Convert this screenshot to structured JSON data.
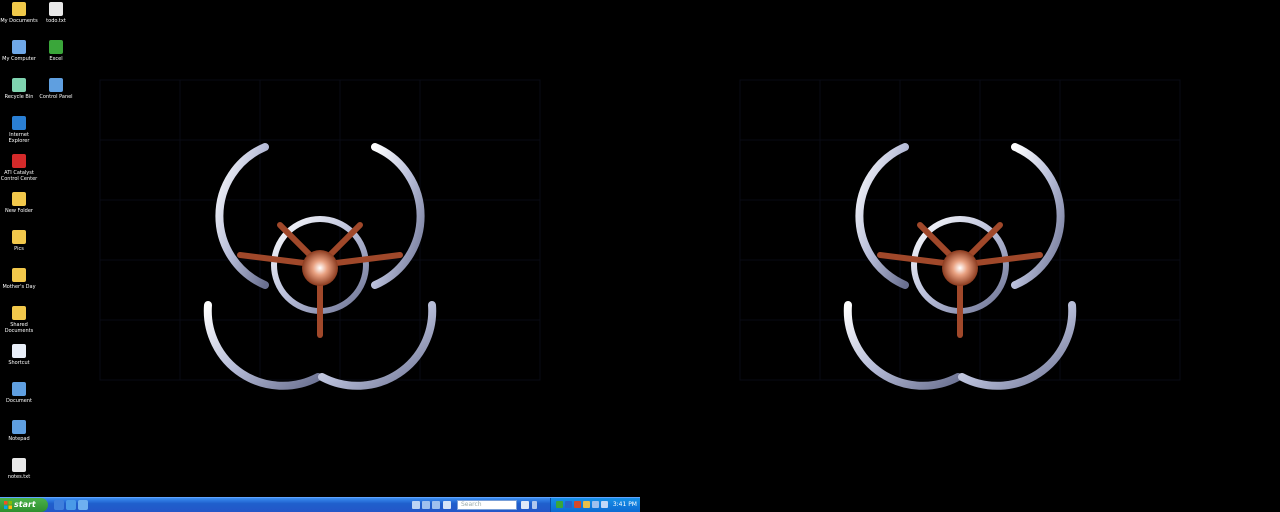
{
  "desktop_icons": [
    {
      "id": "my-documents",
      "label": "My Documents",
      "icon": "folder-documents-icon",
      "color": "#f0c94a",
      "col": 0,
      "row": 0
    },
    {
      "id": "todo",
      "label": "todo.txt",
      "icon": "text-file-icon",
      "color": "#e8e8e8",
      "col": 1,
      "row": 0
    },
    {
      "id": "my-computer",
      "label": "My Computer",
      "icon": "computer-icon",
      "color": "#6fa8e8",
      "col": 0,
      "row": 1
    },
    {
      "id": "excel",
      "label": "Excel",
      "icon": "excel-icon",
      "color": "#3aa63a",
      "col": 1,
      "row": 1
    },
    {
      "id": "recycle-bin",
      "label": "Recycle Bin",
      "icon": "recycle-bin-icon",
      "color": "#7fd4b0",
      "col": 0,
      "row": 2
    },
    {
      "id": "control",
      "label": "Control Panel",
      "icon": "control-panel-icon",
      "color": "#5f9fe0",
      "col": 1,
      "row": 2
    },
    {
      "id": "internet-explorer",
      "label": "Internet Explorer",
      "icon": "internet-explorer-icon",
      "color": "#2a7fd4",
      "col": 0,
      "row": 3
    },
    {
      "id": "ati",
      "label": "ATI Catalyst Control Center",
      "icon": "ati-icon",
      "color": "#d42a2a",
      "col": 0,
      "row": 4
    },
    {
      "id": "folder-1",
      "label": "New Folder",
      "icon": "folder-icon",
      "color": "#f2c84b",
      "col": 0,
      "row": 5
    },
    {
      "id": "folder-2",
      "label": "Pics",
      "icon": "folder-icon",
      "color": "#f2c84b",
      "col": 0,
      "row": 6
    },
    {
      "id": "folder-mothers",
      "label": "Mother's Day",
      "icon": "folder-icon",
      "color": "#f2c84b",
      "col": 0,
      "row": 7
    },
    {
      "id": "folder-3",
      "label": "Shared Documents",
      "icon": "folder-icon",
      "color": "#f2c84b",
      "col": 0,
      "row": 8
    },
    {
      "id": "window-shortcut",
      "label": "Shortcut",
      "icon": "window-icon",
      "color": "#e8eef8",
      "col": 0,
      "row": 9
    },
    {
      "id": "doc-1",
      "label": "Document",
      "icon": "document-icon",
      "color": "#5f9fe0",
      "col": 0,
      "row": 10
    },
    {
      "id": "doc-2",
      "label": "Notepad",
      "icon": "notepad-icon",
      "color": "#5f9fe0",
      "col": 0,
      "row": 11
    },
    {
      "id": "text-file",
      "label": "notes.txt",
      "icon": "text-file-icon",
      "color": "#e8e8e8",
      "col": 0,
      "row": 12
    }
  ],
  "taskbar": {
    "start_label": "start",
    "search_placeholder": "Search",
    "clock": "3:41 PM"
  },
  "colors": {
    "taskbar": "#2456c8",
    "start": "#3a9e3a",
    "tray": "#0f78dc"
  }
}
